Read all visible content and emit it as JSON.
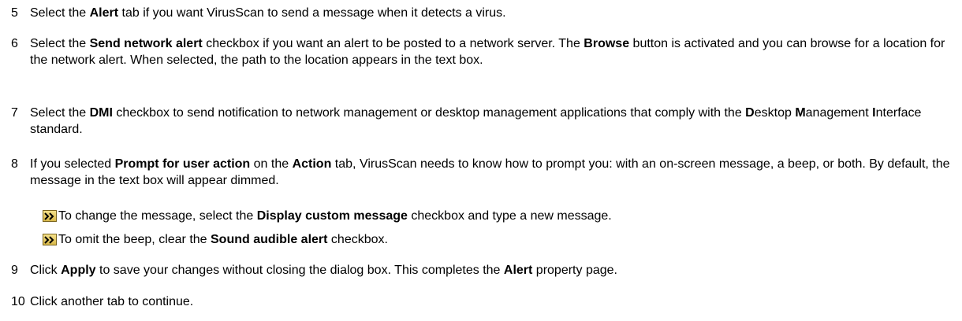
{
  "steps": [
    {
      "num": "5",
      "segments": [
        {
          "t": "Select the "
        },
        {
          "t": "Alert",
          "b": true
        },
        {
          "t": " tab if you want VirusScan to send a message when it detects a virus."
        }
      ]
    },
    {
      "num": "6",
      "segments": [
        {
          "t": "Select the "
        },
        {
          "t": "Send network alert",
          "b": true
        },
        {
          "t": " checkbox if you want an alert to be posted to a network server. The "
        },
        {
          "t": "Browse",
          "b": true
        },
        {
          "t": " button is activated and you can browse for a location for the network alert. When selected, the path to the location appears in the text box."
        }
      ]
    },
    {
      "num": "7",
      "segments": [
        {
          "t": "Select the "
        },
        {
          "t": "DMI",
          "b": true
        },
        {
          "t": " checkbox to send notification to network management or desktop management applications that comply with the "
        },
        {
          "t": "D",
          "b": true
        },
        {
          "t": "esktop "
        },
        {
          "t": "M",
          "b": true
        },
        {
          "t": "anagement "
        },
        {
          "t": "I",
          "b": true
        },
        {
          "t": "nterface standard."
        }
      ]
    },
    {
      "num": "8",
      "segments": [
        {
          "t": "If you selected "
        },
        {
          "t": "Prompt for user action",
          "b": true
        },
        {
          "t": " on the "
        },
        {
          "t": "Action",
          "b": true
        },
        {
          "t": " tab, VirusScan needs to know how to prompt you: with an on-screen message, a beep, or both. By default, the message in the text box will appear dimmed."
        }
      ]
    },
    {
      "num": "9",
      "segments": [
        {
          "t": "Click "
        },
        {
          "t": "Apply",
          "b": true
        },
        {
          "t": " to save your changes without closing the dialog box. This completes the "
        },
        {
          "t": "Alert",
          "b": true
        },
        {
          "t": " property page."
        }
      ]
    },
    {
      "num": "10",
      "segments": [
        {
          "t": "Click another tab to continue."
        }
      ]
    }
  ],
  "bullets": [
    {
      "icon": "arrow-right-double-icon",
      "segments": [
        {
          "t": "To change the message, select the "
        },
        {
          "t": "Display custom message",
          "b": true
        },
        {
          "t": " checkbox and type a new message."
        }
      ]
    },
    {
      "icon": "arrow-right-double-icon",
      "segments": [
        {
          "t": "To omit the beep, clear the "
        },
        {
          "t": "Sound audible alert",
          "b": true
        },
        {
          "t": " checkbox."
        }
      ]
    }
  ]
}
